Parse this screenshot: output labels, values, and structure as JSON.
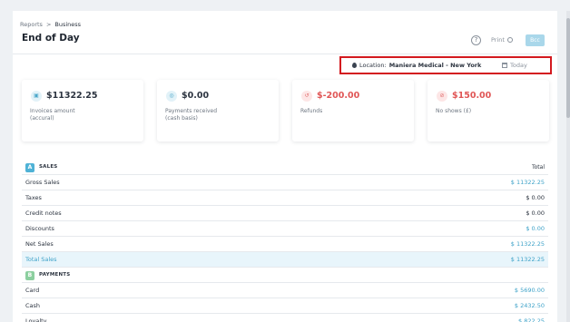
{
  "breadcrumb": {
    "parent": "Reports",
    "separator": ">",
    "current": "Business"
  },
  "page_title": "End of Day",
  "header": {
    "help_glyph": "?",
    "print_label": "Print",
    "primary_label": "Bcc"
  },
  "filter": {
    "location_prefix": "Location:",
    "location_value": "Maniera Medical - New York",
    "date_label": "Today"
  },
  "cards": [
    {
      "value": "$11322.25",
      "caption_line1": "Invoices amount",
      "caption_line2": "(accural)",
      "icon": "invoice-icon"
    },
    {
      "value": "$0.00",
      "caption_line1": "Payments received",
      "caption_line2": "(cash basis)",
      "icon": "payment-icon"
    },
    {
      "value": "$-200.00",
      "caption_line1": "Refunds",
      "caption_line2": "",
      "icon": "refund-icon"
    },
    {
      "value": "$150.00",
      "caption_line1": "No shows (£)",
      "caption_line2": "",
      "icon": "no-show-icon"
    }
  ],
  "sales": {
    "badge": "A",
    "title": "SALES",
    "column_header": "Total",
    "rows": [
      {
        "label": "Gross Sales",
        "amount": "$ 11322.25"
      },
      {
        "label": "Taxes",
        "amount": "$ 0.00"
      },
      {
        "label": "Credit notes",
        "amount": "$ 0.00"
      },
      {
        "label": "Discounts",
        "amount": "$ 0.00"
      },
      {
        "label": "Net Sales",
        "amount": "$ 11322.25"
      },
      {
        "label": "Total Sales",
        "amount": "$ 11322.25"
      }
    ]
  },
  "payments": {
    "badge": "B",
    "title": "PAYMENTS",
    "rows": [
      {
        "label": "Card",
        "amount": "$ 5690.00"
      },
      {
        "label": "Cash",
        "amount": "$ 2432.50"
      },
      {
        "label": "Loyalty",
        "amount": "$ 822.25"
      }
    ]
  },
  "colors": {
    "accent": "#3ea2c8",
    "highlight_border": "#d3191f",
    "negative": "#e05656",
    "total_row_bg": "#e8f5fb"
  }
}
